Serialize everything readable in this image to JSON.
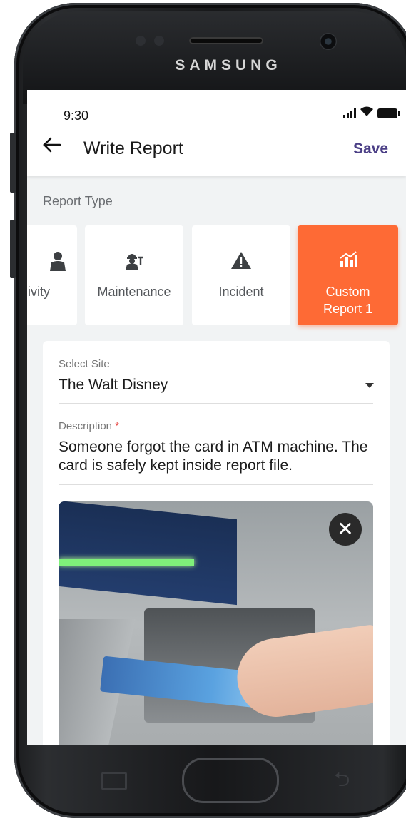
{
  "device": {
    "brand": "SAMSUNG"
  },
  "status_bar": {
    "time": "9:30"
  },
  "app_bar": {
    "back_icon": "arrow-left-icon",
    "title": "Write Report",
    "save_label": "Save"
  },
  "report_type": {
    "label": "Report Type",
    "options": [
      {
        "label": "ivity",
        "icon": "guard-icon"
      },
      {
        "label": "Maintenance",
        "icon": "worker-icon"
      },
      {
        "label": "Incident",
        "icon": "warning-icon"
      },
      {
        "label": "Custom Report 1",
        "icon": "chart-icon",
        "selected": true
      }
    ],
    "accent_color": "#fe6a35"
  },
  "form": {
    "site": {
      "label": "Select Site",
      "value": "The Walt Disney"
    },
    "description": {
      "label": "Description",
      "required_mark": "*",
      "value": "Someone forgot the card in ATM machine. The card is safely kept inside report file."
    },
    "attachment": {
      "close_icon": "close-icon"
    }
  }
}
